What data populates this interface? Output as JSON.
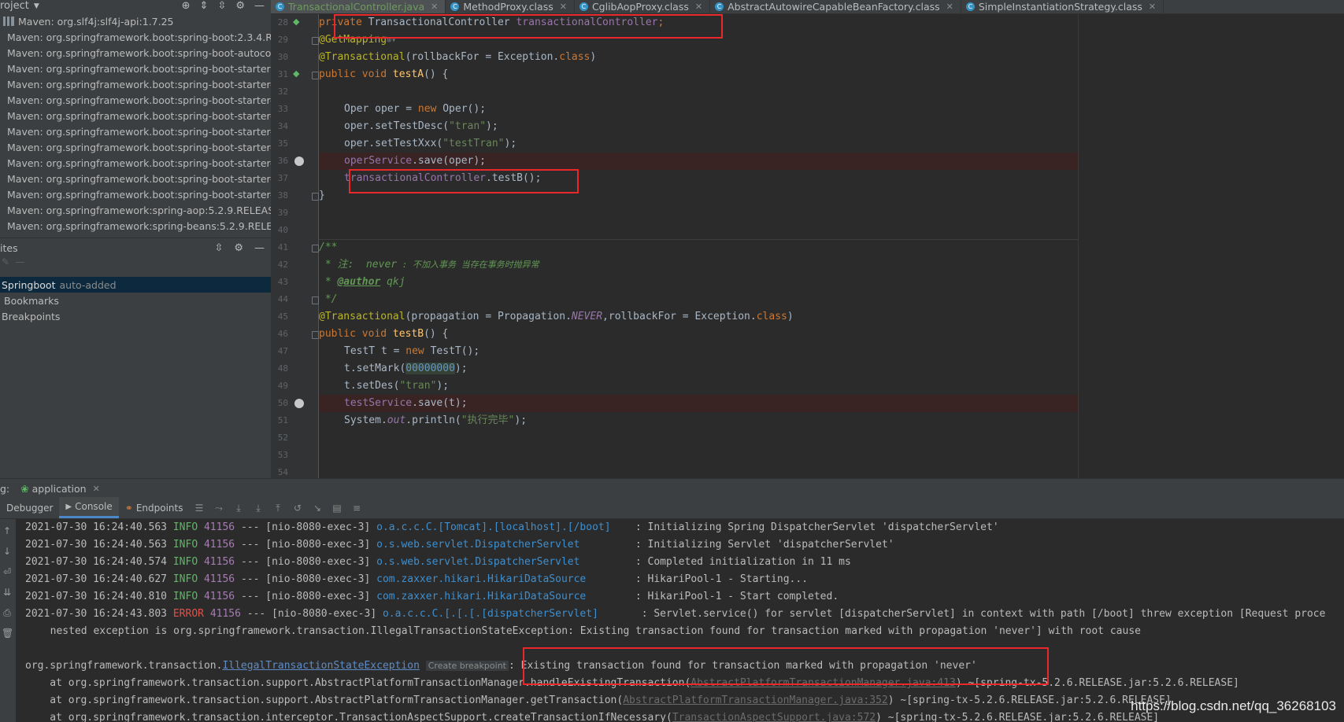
{
  "project": {
    "header": "roject",
    "libs": [
      "Maven: org.slf4j:slf4j-api:1.7.25",
      "Maven: org.springframework.boot:spring-boot:2.3.4.RE",
      "Maven: org.springframework.boot:spring-boot-autocon",
      "Maven: org.springframework.boot:spring-boot-starter:",
      "Maven: org.springframework.boot:spring-boot-starter-",
      "Maven: org.springframework.boot:spring-boot-starter-",
      "Maven: org.springframework.boot:spring-boot-starter-",
      "Maven: org.springframework.boot:spring-boot-starter-",
      "Maven: org.springframework.boot:spring-boot-starter-",
      "Maven: org.springframework.boot:spring-boot-starter-",
      "Maven: org.springframework.boot:spring-boot-starter-",
      "Maven: org.springframework.boot:spring-boot-starter-",
      "Maven: org.springframework:spring-aop:5.2.9.RELEASE",
      "Maven: org.springframework:spring-beans:5.2.9.RELEAS"
    ]
  },
  "favorites": {
    "header": "ites",
    "springboot": "Springboot",
    "springboot_note": "auto-added",
    "bookmarks": "Bookmarks",
    "breakpoints": "Breakpoints"
  },
  "tabs": [
    {
      "label": "TransactionalController.java",
      "active": true
    },
    {
      "label": "MethodProxy.class",
      "active": false
    },
    {
      "label": "CglibAopProxy.class",
      "active": false
    },
    {
      "label": "AbstractAutowireCapableBeanFactory.class",
      "active": false
    },
    {
      "label": "SimpleInstantiationStrategy.class",
      "active": false
    }
  ],
  "editor": {
    "line_numbers": [
      "28",
      "29",
      "30",
      "31",
      "32",
      "33",
      "34",
      "35",
      "36",
      "37",
      "38",
      "39",
      "40",
      "41",
      "42",
      "43",
      "44",
      "45",
      "46",
      "47",
      "48",
      "49",
      "50",
      "51",
      "52",
      "53",
      "54"
    ]
  },
  "code": {
    "l28": {
      "a": "private ",
      "b": "TransactionalController ",
      "c": "transactionalController",
      "d": ";"
    },
    "l29": {
      "a": "@GetMapping"
    },
    "l30": {
      "a": "@Transactional",
      "b": "(rollbackFor = Exception.",
      "c": "class",
      "d": ")"
    },
    "l31": {
      "a": "public void ",
      "b": "testA",
      "c": "() {"
    },
    "l33": {
      "a": "Oper oper = ",
      "b": "new ",
      "c": "Oper();"
    },
    "l34": {
      "a": "oper.setTestDesc(",
      "b": "\"tran\"",
      "c": ");"
    },
    "l35": {
      "a": "oper.setTestXxx(",
      "b": "\"testTran\"",
      "c": ");"
    },
    "l36": {
      "a": "operService",
      "b": ".save(oper);"
    },
    "l37": {
      "a": "transactionalController",
      "b": ".testB();"
    },
    "l38": {
      "a": "}"
    },
    "l41": {
      "a": "/**"
    },
    "l42": {
      "a": " * 注:  ",
      "b": "never",
      "c": " : 不加入事务 当存在事务时抛异常"
    },
    "l43": {
      "a": " * ",
      "b": "@author",
      "c": " qkj"
    },
    "l44": {
      "a": " */"
    },
    "l45": {
      "a": "@Transactional",
      "b": "(propagation = Propagation.",
      "c": "NEVER",
      "d": ",rollbackFor = Exception.",
      "e": "class",
      "f": ")"
    },
    "l46": {
      "a": "public void ",
      "b": "testB",
      "c": "() {"
    },
    "l47": {
      "a": "TestT t = ",
      "b": "new ",
      "c": "TestT();"
    },
    "l48": {
      "a": "t.setMark(",
      "b": "00000000",
      "c": ");"
    },
    "l49": {
      "a": "t.setDes(",
      "b": "\"tran\"",
      "c": ");"
    },
    "l50": {
      "a": "testService",
      "b": ".save(t);"
    },
    "l51": {
      "a": "System.",
      "b": "out",
      "c": ".println(",
      "d": "\"执行完毕\"",
      "e": ");"
    }
  },
  "run": {
    "prefix": "g:",
    "tab": "application",
    "debugger": "Debugger",
    "console": "Console",
    "endpoints": "Endpoints"
  },
  "logs": [
    {
      "ts": "2021-07-30 16:24:40.563",
      "lvl": "INFO",
      "pid": "41156",
      "th": " --- [nio-8080-exec-3] ",
      "lg": "o.a.c.c.C.[Tomcat].[localhost].[/boot]   ",
      "msg": " : Initializing Spring DispatcherServlet 'dispatcherServlet'"
    },
    {
      "ts": "2021-07-30 16:24:40.563",
      "lvl": "INFO",
      "pid": "41156",
      "th": " --- [nio-8080-exec-3] ",
      "lg": "o.s.web.servlet.DispatcherServlet        ",
      "msg": " : Initializing Servlet 'dispatcherServlet'"
    },
    {
      "ts": "2021-07-30 16:24:40.574",
      "lvl": "INFO",
      "pid": "41156",
      "th": " --- [nio-8080-exec-3] ",
      "lg": "o.s.web.servlet.DispatcherServlet        ",
      "msg": " : Completed initialization in 11 ms"
    },
    {
      "ts": "2021-07-30 16:24:40.627",
      "lvl": "INFO",
      "pid": "41156",
      "th": " --- [nio-8080-exec-3] ",
      "lg": "com.zaxxer.hikari.HikariDataSource       ",
      "msg": " : HikariPool-1 - Starting..."
    },
    {
      "ts": "2021-07-30 16:24:40.810",
      "lvl": "INFO",
      "pid": "41156",
      "th": " --- [nio-8080-exec-3] ",
      "lg": "com.zaxxer.hikari.HikariDataSource       ",
      "msg": " : HikariPool-1 - Start completed."
    },
    {
      "ts": "2021-07-30 16:24:43.803",
      "lvl": "ERROR",
      "pid": "41156",
      "th": " --- [nio-8080-exec-3] ",
      "lg": "o.a.c.c.C.[.[.[.[dispatcherServlet]      ",
      "msg": " : Servlet.service() for servlet [dispatcherServlet] in context with path [/boot] threw exception [Request proce"
    }
  ],
  "nested": "  nested exception is org.springframework.transaction.IllegalTransactionStateException: Existing transaction found for transaction marked with propagation 'never'] with root cause",
  "exc": {
    "pkg": "org.springframework.transaction.",
    "cls": "IllegalTransactionStateException",
    "bp": "Create breakpoint",
    "msg": ": Existing transaction found for transaction marked with propagation 'never'"
  },
  "trace": [
    {
      "a": "    at org.springframework.transaction.support.AbstractPlatformTransactionManager.handleExistingTransaction(",
      "b": "AbstractPlatformTransactionManager.java:413",
      "c": ") ~[spring-tx-5.2.6.RELEASE.jar:5.2.6.RELEASE]"
    },
    {
      "a": "    at org.springframework.transaction.support.AbstractPlatformTransactionManager.getTransaction(",
      "b": "AbstractPlatformTransactionManager.java:352",
      "c": ") ~[spring-tx-5.2.6.RELEASE.jar:5.2.6.RELEASE]"
    },
    {
      "a": "    at org.springframework.transaction.interceptor.TransactionAspectSupport.createTransactionIfNecessary(",
      "b": "TransactionAspectSupport.java:572",
      "c": ") ~[spring-tx-5.2.6.RELEASE.jar:5.2.6.RELEASE]"
    }
  ],
  "watermark": "https://blog.csdn.net/qq_36268103",
  "colors": {
    "accent": "#4a88c7",
    "highlight_box": "#e8282b",
    "error": "#e0514a",
    "info": "#5fb865"
  }
}
